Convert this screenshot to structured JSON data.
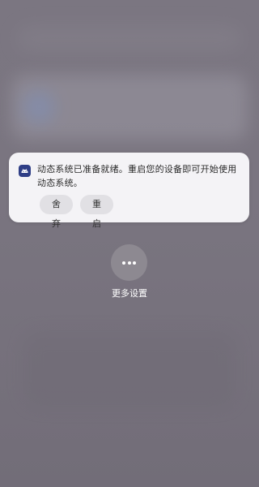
{
  "notification": {
    "app_icon": "android-icon",
    "message": "动态系统已准备就绪。重启您的设备即可开始使用动态系统。",
    "discard_label": "舍弃",
    "restart_label": "重启"
  },
  "more_settings": {
    "icon": "more-dots-icon",
    "label": "更多设置"
  },
  "colors": {
    "icon_bg": "#2f3e86",
    "card_bg": "#f4f3f6",
    "button_bg": "#e1e0e4"
  }
}
